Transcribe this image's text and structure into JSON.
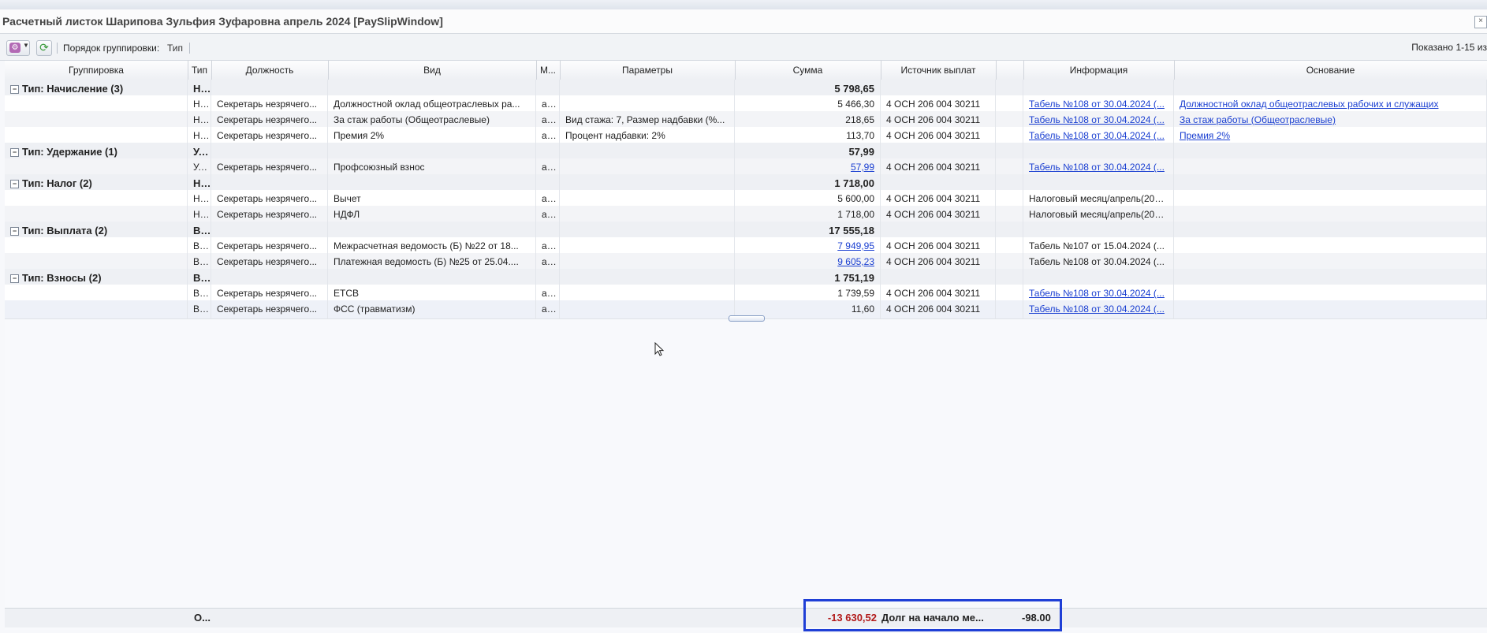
{
  "window": {
    "title": "Расчетный листок Шарипова Зульфия Зуфаровна апрель 2024 [PaySlipWindow]",
    "close_glyph": "×"
  },
  "toolbar": {
    "menu_icon": "gear-menu-icon",
    "refresh_icon": "refresh-icon",
    "grouping_label": "Порядок группировки:",
    "grouping_value": "Тип",
    "shown_text": "Показано 1-15 из"
  },
  "columns": [
    "Группировка",
    "Тип",
    "Должность",
    "Вид",
    "М...",
    "Параметры",
    "Сумма",
    "Источник выплат",
    "",
    "Информация",
    "Основание"
  ],
  "groups": [
    {
      "label": "Тип: Начисление (3)",
      "type": "Н...",
      "sum": "5 798,65",
      "rows": [
        {
          "type": "Н...",
          "position": "Секретарь незрячего...",
          "kind": "Должностной оклад общеотраслевых ра...",
          "m": "а...",
          "params": "",
          "sum": "5 466,30",
          "sum_link": false,
          "source": "4 ОСН 206 004 30211",
          "info": "Табель №108 от 30.04.2024 (...",
          "info_link": true,
          "basis": "Должностной оклад общеотраслевых рабочих и служащих",
          "basis_link": true
        },
        {
          "type": "Н...",
          "position": "Секретарь незрячего...",
          "kind": "За стаж работы (Общеотраслевые)",
          "m": "а...",
          "params": "Вид стажа: 7, Размер надбавки (%...",
          "sum": "218,65",
          "sum_link": false,
          "source": "4 ОСН 206 004 30211",
          "info": "Табель №108 от 30.04.2024 (...",
          "info_link": true,
          "basis": "За стаж работы (Общеотраслевые)",
          "basis_link": true
        },
        {
          "type": "Н...",
          "position": "Секретарь незрячего...",
          "kind": "Премия 2%",
          "m": "а...",
          "params": "Процент надбавки: 2%",
          "sum": "113,70",
          "sum_link": false,
          "source": "4 ОСН 206 004 30211",
          "info": "Табель №108 от 30.04.2024 (...",
          "info_link": true,
          "basis": "Премия 2%",
          "basis_link": true
        }
      ]
    },
    {
      "label": "Тип: Удержание (1)",
      "type": "У...",
      "sum": "57,99",
      "rows": [
        {
          "type": "У...",
          "position": "Секретарь незрячего...",
          "kind": "Профсоюзный взнос",
          "m": "а...",
          "params": "",
          "sum": "57,99",
          "sum_link": true,
          "source": "4 ОСН 206 004 30211",
          "info": "Табель №108 от 30.04.2024 (...",
          "info_link": true,
          "basis": "",
          "basis_link": false
        }
      ]
    },
    {
      "label": "Тип: Налог (2)",
      "type": "Н...",
      "sum": "1 718,00",
      "rows": [
        {
          "type": "Н...",
          "position": "Секретарь незрячего...",
          "kind": "Вычет",
          "m": "а...",
          "params": "",
          "sum": "5 600,00",
          "sum_link": false,
          "source": "4 ОСН 206 004 30211",
          "info": "Налоговый месяц/апрель(2024)",
          "info_link": false,
          "basis": "",
          "basis_link": false
        },
        {
          "type": "Н...",
          "position": "Секретарь незрячего...",
          "kind": "НДФЛ",
          "m": "а...",
          "params": "",
          "sum": "1 718,00",
          "sum_link": false,
          "source": "4 ОСН 206 004 30211",
          "info": "Налоговый месяц/апрель(2024)",
          "info_link": false,
          "basis": "",
          "basis_link": false
        }
      ]
    },
    {
      "label": "Тип: Выплата (2)",
      "type": "В...",
      "sum": "17 555,18",
      "rows": [
        {
          "type": "В...",
          "position": "Секретарь незрячего...",
          "kind": "Межрасчетная ведомость (Б) №22 от 18...",
          "m": "а...",
          "params": "",
          "sum": "7 949,95",
          "sum_link": true,
          "source": "4 ОСН 206 004 30211",
          "info": "Табель №107 от 15.04.2024 (...",
          "info_link": false,
          "basis": "",
          "basis_link": false
        },
        {
          "type": "В...",
          "position": "Секретарь незрячего...",
          "kind": "Платежная ведомость (Б) №25 от 25.04....",
          "m": "а...",
          "params": "",
          "sum": "9 605,23",
          "sum_link": true,
          "source": "4 ОСН 206 004 30211",
          "info": "Табель №108 от 30.04.2024 (...",
          "info_link": false,
          "basis": "",
          "basis_link": false
        }
      ]
    },
    {
      "label": "Тип: Взносы (2)",
      "type": "В...",
      "sum": "1 751,19",
      "rows": [
        {
          "type": "В...",
          "position": "Секретарь незрячего...",
          "kind": "ЕТСВ",
          "m": "а...",
          "params": "",
          "sum": "1 739,59",
          "sum_link": false,
          "source": "4 ОСН 206 004 30211",
          "info": "Табель №108 от 30.04.2024 (...",
          "info_link": true,
          "basis": "",
          "basis_link": false
        },
        {
          "type": "В...",
          "position": "Секретарь незрячего...",
          "kind": "ФСС (травматизм)",
          "m": "а...",
          "params": "",
          "sum": "11,60",
          "sum_link": false,
          "source": "4 ОСН 206 004 30211",
          "info": "Табель №108 от 30.04.2024 (...",
          "info_link": true,
          "basis": "",
          "basis_link": false
        }
      ]
    }
  ],
  "footer": {
    "type": "О...",
    "total": "-13 630,52",
    "debt_label": "Долг на начало ме...",
    "debt_value": "-98.00",
    "total_color": "#b21a1a",
    "highlight_color": "#1f3fd6"
  }
}
